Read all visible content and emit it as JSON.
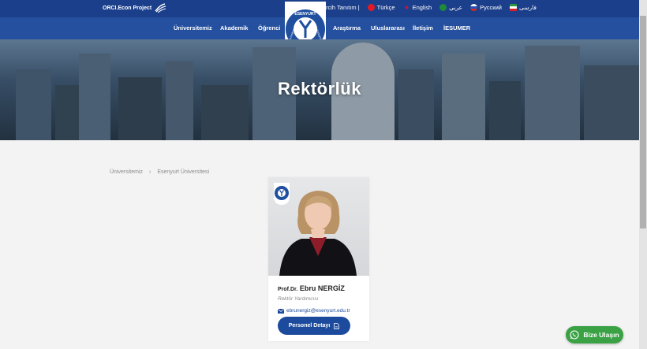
{
  "header": {
    "brand": "ORCI.Econ Project",
    "tercih": "Tercih Tanıtım |",
    "languages": [
      {
        "label": "Türkçe",
        "flag_color": "#e21b23"
      },
      {
        "label": "English",
        "flag_color": "#213e8e"
      },
      {
        "label": "عربي",
        "flag_color": "#1f8a3a"
      },
      {
        "label": "Русский",
        "flag_color": "#2b50b5"
      },
      {
        "label": "فارسی",
        "flag_color": "#2a9a3d"
      }
    ],
    "menu": [
      "Üniversitemiz",
      "Akademik",
      "Öğrenci",
      "Araştırma",
      "Uluslararası",
      "İletişim",
      "İESUMER"
    ],
    "logo": {
      "top": "ESENYURT",
      "left": "İSTANBUL",
      "right": "ÜNİVERSİTESİ",
      "year": "2013"
    }
  },
  "hero": {
    "title": "Rektörlük"
  },
  "breadcrumb": [
    "Üniversitemiz",
    "›",
    "Esenyurt Üniversitesi"
  ],
  "profile": {
    "title": "Prof.Dr.",
    "name": "Ebru NERGİZ",
    "role": "Rektör Yardımcısı",
    "email": "ebrunergiz@esenyurt.edu.tr",
    "button": "Personel Detayı"
  },
  "whatsapp": {
    "label": "Bize Ulaşın"
  },
  "colors": {
    "brand": "#24509f",
    "topbar": "#1b3f8b",
    "whatsapp": "#3aa244"
  }
}
